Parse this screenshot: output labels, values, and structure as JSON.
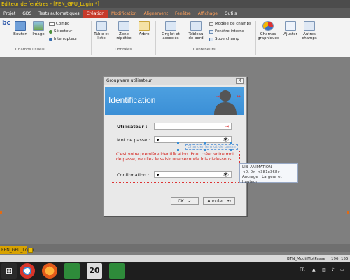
{
  "window_title": "Éditeur de fenêtres - [FEN_GPU_Login *]",
  "tabs": [
    {
      "label": "Projet",
      "active": false,
      "hl": false
    },
    {
      "label": "GDS",
      "active": false,
      "hl": false
    },
    {
      "label": "Tests automatiques",
      "active": false,
      "hl": false
    },
    {
      "label": "Création",
      "active": true,
      "hl": false
    },
    {
      "label": "Modification",
      "active": false,
      "hl": true
    },
    {
      "label": "Alignement",
      "active": false,
      "hl": true
    },
    {
      "label": "Fenêtre",
      "active": false,
      "hl": true
    },
    {
      "label": "Affichage",
      "active": false,
      "hl": true
    },
    {
      "label": "Outils",
      "active": false,
      "hl": false
    }
  ],
  "ribbon": {
    "libelle": "bc",
    "bouton": "Bouton",
    "image": "Image",
    "combo": "Combo",
    "selecteur": "Sélecteur",
    "interrupteur": "Interrupteur",
    "champs_usuels": "Champs usuels",
    "table": "Table et liste",
    "zone": "Zone répétée",
    "arbre": "Arbre",
    "donnees": "Données",
    "onglet": "Onglet et associés",
    "tableau": "Tableau de bord",
    "modele": "Modèle de champs",
    "fenetre_interne": "Fenêtre interne",
    "superchamp": "Superchamp",
    "conteneurs": "Conteneurs",
    "champs_graphiques": "Champs graphiques",
    "ajuster": "Ajuster",
    "autres": "Autres champs"
  },
  "dialog": {
    "title": "Groupware utilisateur",
    "close": "X",
    "banner": "Identification",
    "utilisateur": "Utilisateur :",
    "mot_de_passe": "Mot de passe :",
    "changer": "Changer le mot de passe",
    "msg": "C'est votre première identification. Pour créer votre mot de passe, veuillez le saisir une seconde fois ci-dessous.",
    "confirmation": "Confirmation :",
    "ok": "OK",
    "annuler": "Annuler"
  },
  "tooltip": {
    "name": "LIB_ANIMATION",
    "pos": "<0, 0> <381x368>",
    "ancrage": "Ancrage : Largeur et hauteur"
  },
  "doc_tab": "FEN_GPU_Login",
  "status": {
    "button": "BTN_ModifMotPasse",
    "coords": "196, 155"
  },
  "tray": {
    "lang": "FR"
  },
  "colors": {
    "accent": "#c73b2b",
    "banner": "#3b8fd6",
    "message": "#d3201a"
  }
}
